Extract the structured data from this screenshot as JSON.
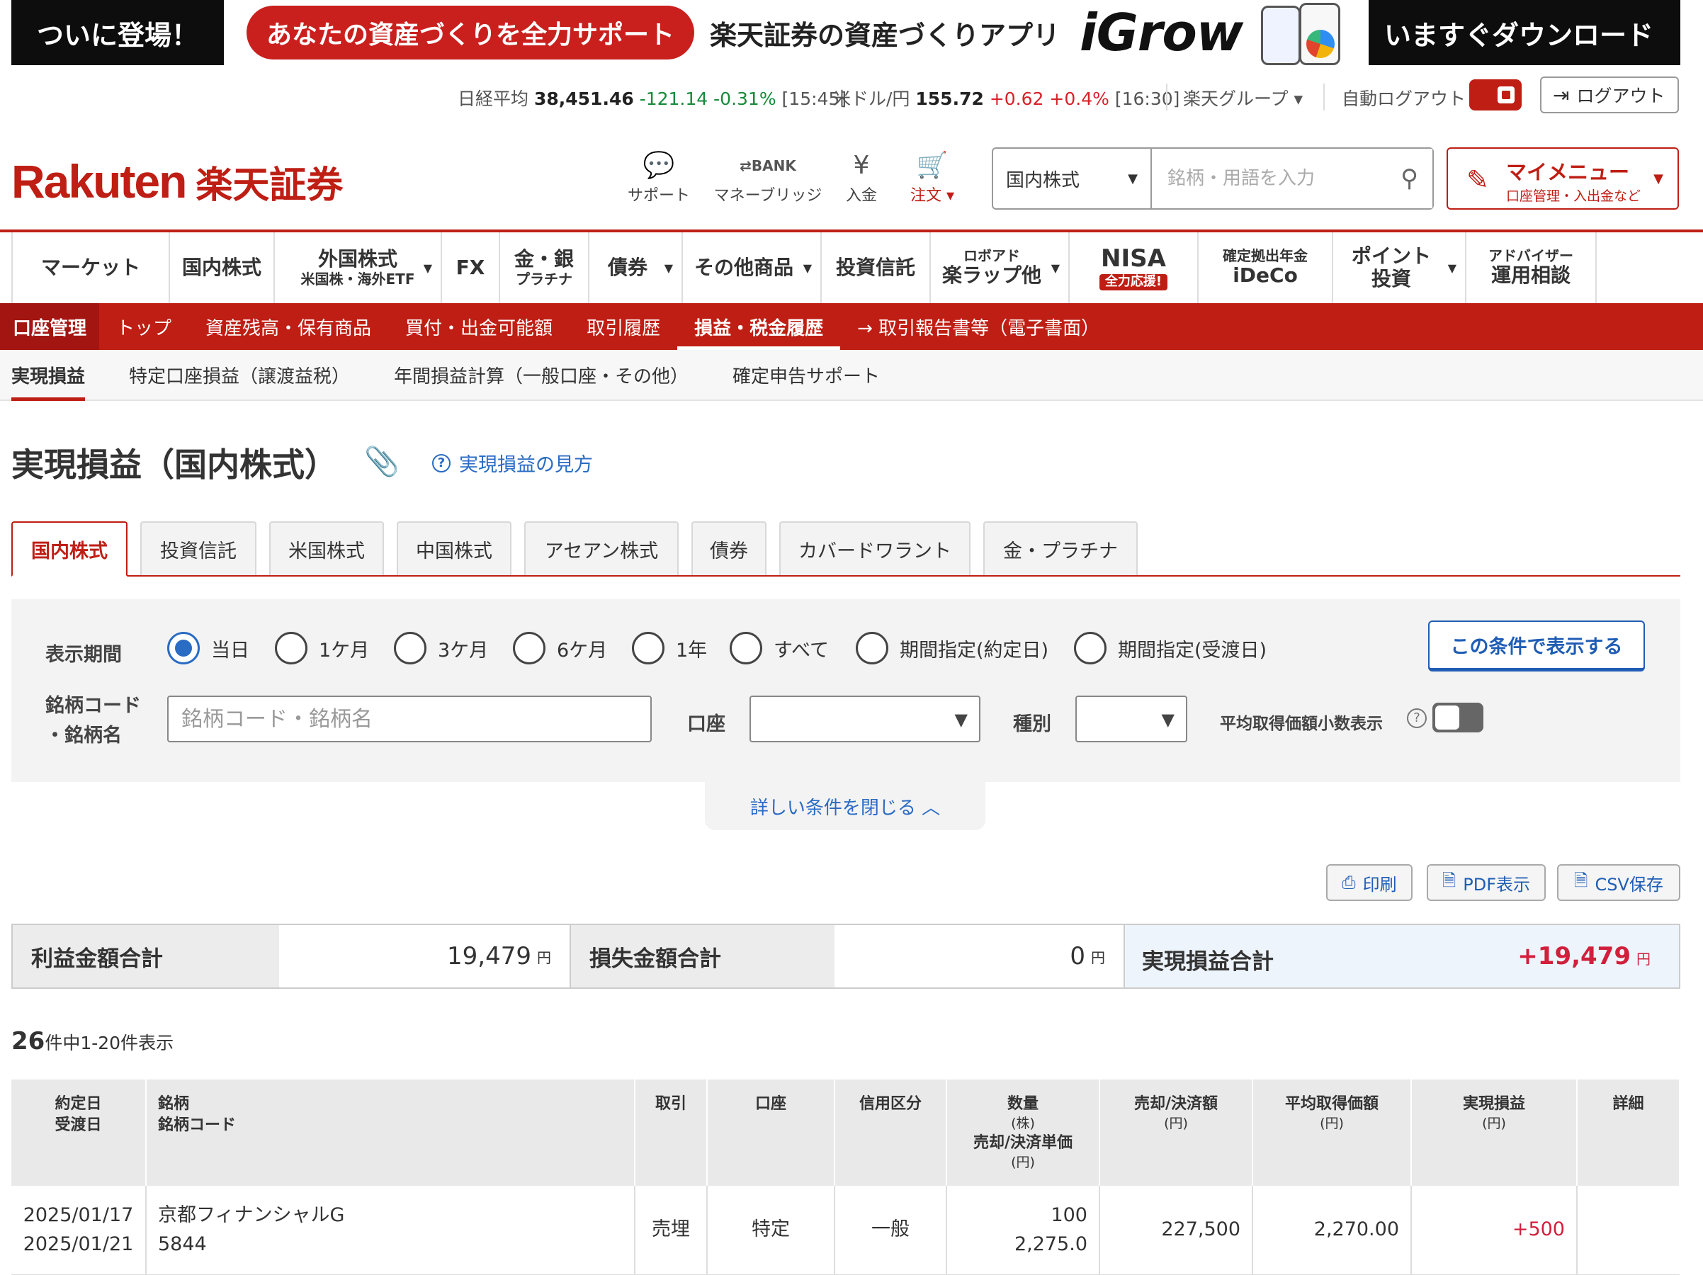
{
  "banner": {
    "lead": "ついに登場！",
    "pill": "あなたの資産づくりを全力サポート",
    "app": "楽天証券の資産づくりアプリ",
    "brand": "iGrow",
    "cta": "いますぐダウンロード"
  },
  "ticker": {
    "nikkei_label": "日経平均",
    "nikkei_value": "38,451.46",
    "nikkei_change": "-121.14",
    "nikkei_pct": "-0.31%",
    "nikkei_time": "[15:45]",
    "usdjpy_label": "米ドル/円",
    "usdjpy_value": "155.72",
    "usdjpy_change": "+0.62",
    "usdjpy_pct": "+0.4%",
    "usdjpy_time": "[16:30]",
    "group": "楽天グループ ▾",
    "auto_logout": "自動ログアウト",
    "logout": "ログアウト"
  },
  "header": {
    "logo_en": "Rakuten",
    "logo_jp": "楽天証券",
    "icons": [
      {
        "label": "サポート",
        "icon": "support-chat-icon"
      },
      {
        "label": "マネーブリッジ",
        "icon": "bank-transfer-icon"
      },
      {
        "label": "入金",
        "icon": "deposit-yen-icon"
      },
      {
        "label": "注文 ▾",
        "icon": "cart-icon"
      }
    ],
    "search_select": "国内株式",
    "search_placeholder": "銘柄・用語を入力",
    "mymenu_title": "マイメニュー",
    "mymenu_sub": "口座管理・入出金など"
  },
  "mainnav": [
    {
      "line1": "マーケット",
      "line2": ""
    },
    {
      "line1": "国内株式",
      "line2": ""
    },
    {
      "line1": "外国株式",
      "line2": "米国株・海外ETF"
    },
    {
      "line1": "FX",
      "line2": ""
    },
    {
      "line1": "金・銀",
      "line2": "プラチナ"
    },
    {
      "line1": "債券",
      "line2": ""
    },
    {
      "line1": "その他商品",
      "line2": ""
    },
    {
      "line1": "投資信託",
      "line2": ""
    },
    {
      "line1": "ロボアド",
      "line2": "楽ラップ他"
    },
    {
      "line1": "NISA",
      "line2": "全力応援!"
    },
    {
      "line1": "確定拠出年金",
      "line2": "iDeCo"
    },
    {
      "line1": "ポイント",
      "line2": "投資"
    },
    {
      "line1": "アドバイザー",
      "line2": "運用相談"
    }
  ],
  "acctnav": {
    "label": "口座管理",
    "links": [
      "トップ",
      "資産残高・保有商品",
      "買付・出金可能額",
      "取引履歴",
      "損益・税金履歴",
      "→ 取引報告書等（電子書面）"
    ],
    "active_index": 4
  },
  "subnav": [
    "実現損益",
    "特定口座損益（譲渡益税）",
    "年間損益計算（一般口座・その他）",
    "確定申告サポート"
  ],
  "page": {
    "title": "実現損益（国内株式）",
    "help": "実現損益の見方"
  },
  "tabs": [
    "国内株式",
    "投資信託",
    "米国株式",
    "中国株式",
    "アセアン株式",
    "債券",
    "カバードワラント",
    "金・プラチナ"
  ],
  "filter": {
    "period_label": "表示期間",
    "periods": [
      "当日",
      "1ケ月",
      "3ケ月",
      "6ケ月",
      "1年",
      "すべて",
      "期間指定(約定日)",
      "期間指定(受渡日)"
    ],
    "selected_period": "当日",
    "show_button": "この条件で表示する",
    "code_label_1": "銘柄コード",
    "code_label_2": "・銘柄名",
    "code_placeholder": "銘柄コード・銘柄名",
    "account_label": "口座",
    "type_label": "種別",
    "avg_label": "平均取得価額小数表示",
    "close_conditions": "詳しい条件を閉じる ︿"
  },
  "actions": {
    "print": "印刷",
    "pdf": "PDF表示",
    "csv": "CSV保存"
  },
  "summary": {
    "profit_label": "利益金額合計",
    "profit_value": "19,479",
    "loss_label": "損失金額合計",
    "loss_value": "0",
    "total_label": "実現損益合計",
    "total_value": "+19,479",
    "yen": "円"
  },
  "count": {
    "total": "26",
    "text": "件中1-20件表示"
  },
  "table": {
    "headers": {
      "date1": "約定日",
      "date2": "受渡日",
      "name1": "銘柄",
      "name2": "銘柄コード",
      "trade": "取引",
      "account": "口座",
      "margin": "信用区分",
      "qty": "数量",
      "qty_unit": "(株)",
      "price": "売却/決済単価",
      "price_unit": "(円)",
      "amount": "売却/決済額",
      "amount_unit": "(円)",
      "avg": "平均取得価額",
      "avg_unit": "(円)",
      "pnl": "実現損益",
      "pnl_unit": "(円)",
      "detail": "詳細"
    },
    "rows": [
      {
        "trade_date": "2025/01/17",
        "settle_date": "2025/01/21",
        "name": "京都フィナンシャルG",
        "code": "5844",
        "trade": "売埋",
        "account": "特定",
        "margin": "一般",
        "qty": "100",
        "price": "2,275.0",
        "amount": "227,500",
        "avg": "2,270.00",
        "pnl": "+500"
      }
    ]
  },
  "colors": {
    "brand_red": "#bf1e14",
    "link_blue": "#2a6bc4",
    "profit_red": "#d0203c",
    "loss_green": "#168a3a"
  }
}
